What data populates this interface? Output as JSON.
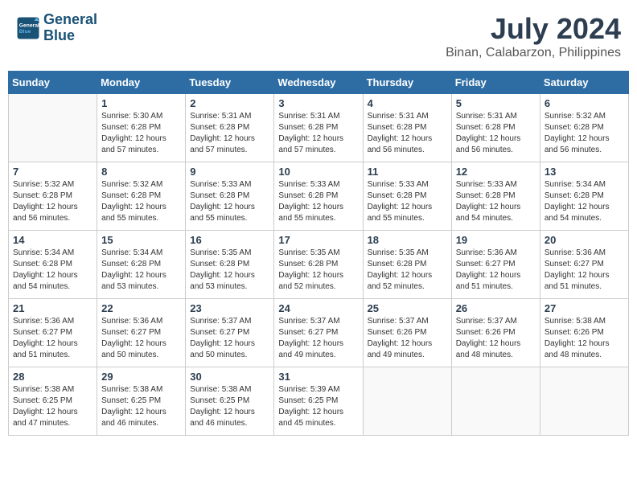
{
  "logo": {
    "line1": "General",
    "line2": "Blue"
  },
  "title": "July 2024",
  "subtitle": "Binan, Calabarzon, Philippines",
  "headers": [
    "Sunday",
    "Monday",
    "Tuesday",
    "Wednesday",
    "Thursday",
    "Friday",
    "Saturday"
  ],
  "weeks": [
    [
      {
        "day": "",
        "info": ""
      },
      {
        "day": "1",
        "info": "Sunrise: 5:30 AM\nSunset: 6:28 PM\nDaylight: 12 hours\nand 57 minutes."
      },
      {
        "day": "2",
        "info": "Sunrise: 5:31 AM\nSunset: 6:28 PM\nDaylight: 12 hours\nand 57 minutes."
      },
      {
        "day": "3",
        "info": "Sunrise: 5:31 AM\nSunset: 6:28 PM\nDaylight: 12 hours\nand 57 minutes."
      },
      {
        "day": "4",
        "info": "Sunrise: 5:31 AM\nSunset: 6:28 PM\nDaylight: 12 hours\nand 56 minutes."
      },
      {
        "day": "5",
        "info": "Sunrise: 5:31 AM\nSunset: 6:28 PM\nDaylight: 12 hours\nand 56 minutes."
      },
      {
        "day": "6",
        "info": "Sunrise: 5:32 AM\nSunset: 6:28 PM\nDaylight: 12 hours\nand 56 minutes."
      }
    ],
    [
      {
        "day": "7",
        "info": "Sunrise: 5:32 AM\nSunset: 6:28 PM\nDaylight: 12 hours\nand 56 minutes."
      },
      {
        "day": "8",
        "info": "Sunrise: 5:32 AM\nSunset: 6:28 PM\nDaylight: 12 hours\nand 55 minutes."
      },
      {
        "day": "9",
        "info": "Sunrise: 5:33 AM\nSunset: 6:28 PM\nDaylight: 12 hours\nand 55 minutes."
      },
      {
        "day": "10",
        "info": "Sunrise: 5:33 AM\nSunset: 6:28 PM\nDaylight: 12 hours\nand 55 minutes."
      },
      {
        "day": "11",
        "info": "Sunrise: 5:33 AM\nSunset: 6:28 PM\nDaylight: 12 hours\nand 55 minutes."
      },
      {
        "day": "12",
        "info": "Sunrise: 5:33 AM\nSunset: 6:28 PM\nDaylight: 12 hours\nand 54 minutes."
      },
      {
        "day": "13",
        "info": "Sunrise: 5:34 AM\nSunset: 6:28 PM\nDaylight: 12 hours\nand 54 minutes."
      }
    ],
    [
      {
        "day": "14",
        "info": "Sunrise: 5:34 AM\nSunset: 6:28 PM\nDaylight: 12 hours\nand 54 minutes."
      },
      {
        "day": "15",
        "info": "Sunrise: 5:34 AM\nSunset: 6:28 PM\nDaylight: 12 hours\nand 53 minutes."
      },
      {
        "day": "16",
        "info": "Sunrise: 5:35 AM\nSunset: 6:28 PM\nDaylight: 12 hours\nand 53 minutes."
      },
      {
        "day": "17",
        "info": "Sunrise: 5:35 AM\nSunset: 6:28 PM\nDaylight: 12 hours\nand 52 minutes."
      },
      {
        "day": "18",
        "info": "Sunrise: 5:35 AM\nSunset: 6:28 PM\nDaylight: 12 hours\nand 52 minutes."
      },
      {
        "day": "19",
        "info": "Sunrise: 5:36 AM\nSunset: 6:27 PM\nDaylight: 12 hours\nand 51 minutes."
      },
      {
        "day": "20",
        "info": "Sunrise: 5:36 AM\nSunset: 6:27 PM\nDaylight: 12 hours\nand 51 minutes."
      }
    ],
    [
      {
        "day": "21",
        "info": "Sunrise: 5:36 AM\nSunset: 6:27 PM\nDaylight: 12 hours\nand 51 minutes."
      },
      {
        "day": "22",
        "info": "Sunrise: 5:36 AM\nSunset: 6:27 PM\nDaylight: 12 hours\nand 50 minutes."
      },
      {
        "day": "23",
        "info": "Sunrise: 5:37 AM\nSunset: 6:27 PM\nDaylight: 12 hours\nand 50 minutes."
      },
      {
        "day": "24",
        "info": "Sunrise: 5:37 AM\nSunset: 6:27 PM\nDaylight: 12 hours\nand 49 minutes."
      },
      {
        "day": "25",
        "info": "Sunrise: 5:37 AM\nSunset: 6:26 PM\nDaylight: 12 hours\nand 49 minutes."
      },
      {
        "day": "26",
        "info": "Sunrise: 5:37 AM\nSunset: 6:26 PM\nDaylight: 12 hours\nand 48 minutes."
      },
      {
        "day": "27",
        "info": "Sunrise: 5:38 AM\nSunset: 6:26 PM\nDaylight: 12 hours\nand 48 minutes."
      }
    ],
    [
      {
        "day": "28",
        "info": "Sunrise: 5:38 AM\nSunset: 6:25 PM\nDaylight: 12 hours\nand 47 minutes."
      },
      {
        "day": "29",
        "info": "Sunrise: 5:38 AM\nSunset: 6:25 PM\nDaylight: 12 hours\nand 46 minutes."
      },
      {
        "day": "30",
        "info": "Sunrise: 5:38 AM\nSunset: 6:25 PM\nDaylight: 12 hours\nand 46 minutes."
      },
      {
        "day": "31",
        "info": "Sunrise: 5:39 AM\nSunset: 6:25 PM\nDaylight: 12 hours\nand 45 minutes."
      },
      {
        "day": "",
        "info": ""
      },
      {
        "day": "",
        "info": ""
      },
      {
        "day": "",
        "info": ""
      }
    ]
  ]
}
